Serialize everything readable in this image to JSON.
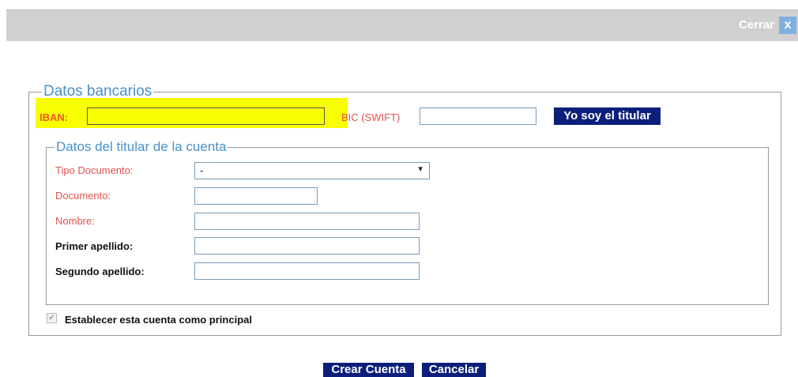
{
  "header": {
    "close_label": "Cerrar",
    "close_icon": "x"
  },
  "bank": {
    "legend": "Datos bancarios",
    "iban_label": "IBAN:",
    "iban_value": "",
    "bic_label": "BIC (SWIFT)",
    "bic_value": "",
    "titular_button": "Yo soy el titular"
  },
  "holder": {
    "legend": "Datos del titular de la cuenta",
    "tipo_label": "Tipo Documento:",
    "tipo_value": "-",
    "documento_label": "Documento:",
    "nombre_label": "Nombre:",
    "primer_label": "Primer apellido:",
    "segundo_label": "Segundo apellido:"
  },
  "principal_label": "Establecer esta cuenta como principal",
  "actions": {
    "create": "Crear Cuenta",
    "cancel": "Cancelar"
  },
  "colors": {
    "accent": "#0b1f7a",
    "legend": "#4a90c8",
    "required": "#e0524f",
    "highlight": "#f7ff00"
  }
}
